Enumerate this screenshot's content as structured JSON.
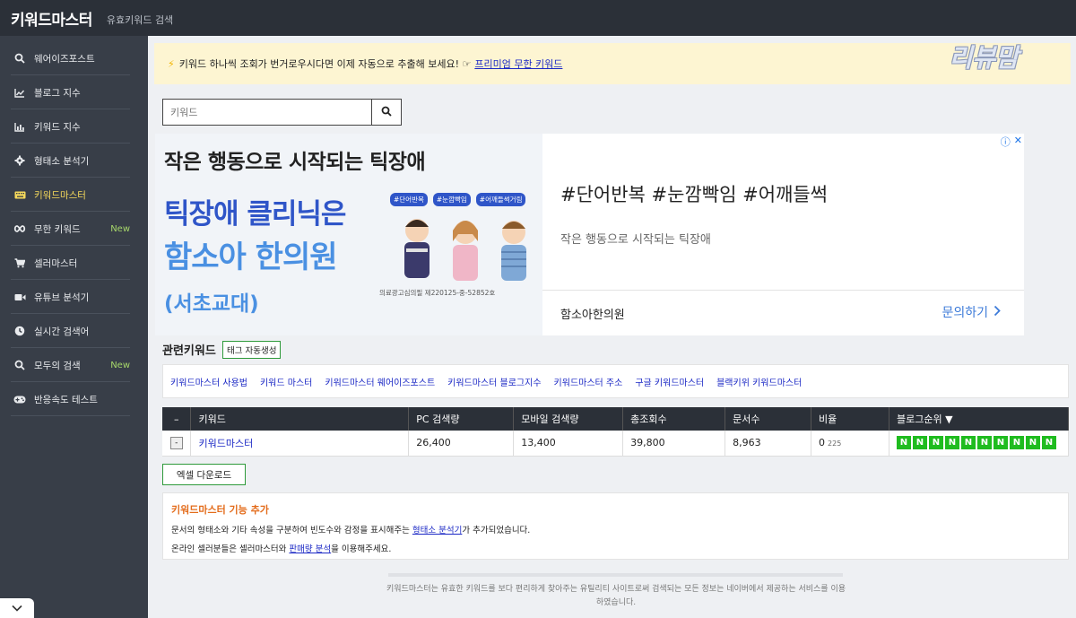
{
  "header": {
    "brand": "키워드마스터",
    "subtitle": "유효키워드 검색"
  },
  "sidebar": {
    "items": [
      {
        "label": "웨어이즈포스트",
        "icon": "search-icon"
      },
      {
        "label": "블로그 지수",
        "icon": "line-chart-icon"
      },
      {
        "label": "키워드 지수",
        "icon": "bar-chart-icon"
      },
      {
        "label": "형태소 분석기",
        "icon": "gear-icon"
      },
      {
        "label": "키워드마스터",
        "icon": "keyboard-icon",
        "active": true
      },
      {
        "label": "무한 키워드",
        "icon": "infinity-icon",
        "badge": "New"
      },
      {
        "label": "셀러마스터",
        "icon": "cart-icon"
      },
      {
        "label": "유튜브 분석기",
        "icon": "video-camera-icon"
      },
      {
        "label": "실시간 검색어",
        "icon": "clock-icon"
      },
      {
        "label": "모두의 검색",
        "icon": "search-icon",
        "badge": "New"
      },
      {
        "label": "반응속도 테스트",
        "icon": "gamepad-icon"
      }
    ]
  },
  "notice": {
    "text": "키워드 하나씩 조회가 번거로우시다면 이제 자동으로 추출해 보세요! ☞",
    "link": "프리미엄 무한 키워드",
    "watermark": "리뷰맘"
  },
  "search": {
    "placeholder": "키워드"
  },
  "ad": {
    "headline": "작은 행동으로 시작되는 틱장애",
    "big1": "틱장애 클리닉은",
    "big2": "함소아 한의원",
    "big3": "(서초교대)",
    "tags": [
      "#단어반복",
      "#눈깜빡임",
      "#어깨들썩거림"
    ],
    "permit": "의료광고심의필 제220125-중-52852호",
    "right_title": "#단어반복 #눈깜빡임 #어깨들썩",
    "right_sub": "작은 행동으로 시작되는 틱장애",
    "advertiser": "함소아한의원",
    "cta": "문의하기"
  },
  "related": {
    "title": "관련키워드",
    "tag_button": "태그 자동생성",
    "keywords": [
      "키워드마스터 사용법",
      "키워드 마스터",
      "키워드마스터 웨어이즈포스트",
      "키워드마스터 블로그지수",
      "키워드마스터 주소",
      "구글 키워드마스터",
      "블랙키위 키워드마스터"
    ]
  },
  "table": {
    "headers": [
      "–",
      "키워드",
      "PC 검색량",
      "모바일 검색량",
      "총조회수",
      "문서수",
      "비율",
      "블로그순위 ▼"
    ],
    "rows": [
      {
        "btn": "-",
        "keyword": "키워드마스터",
        "pc": "26,400",
        "mobile": "13,400",
        "total": "39,800",
        "docs": "8,963",
        "ratio": "0",
        "ratio_small": "225",
        "ranks": [
          "N",
          "N",
          "N",
          "N",
          "N",
          "N",
          "N",
          "N",
          "N",
          "N"
        ]
      }
    ]
  },
  "excel_button": "엑셀 다운로드",
  "feature": {
    "title": "키워드마스터 기능 추가",
    "line1_pre": "문서의 형태소와 기타 속성을 구분하여 빈도수와 감정을 표시해주는 ",
    "line1_link": "형태소 분석기",
    "line1_post": "가 추가되었습니다.",
    "line2_pre": "온라인 셀러분들은 셀러마스터와 ",
    "line2_link": "판매량 분석",
    "line2_post": "을 이용해주세요."
  },
  "footer": {
    "text": "키워드마스터는 유효한 키워드를 보다 편리하게 찾아주는 유틸리티 사이트로써 검색되는 모든 정보는 네이버에서 제공하는 서비스를 이용하였습니다."
  },
  "colors": {
    "topbar": "#2b3038",
    "sidebar": "#383e48",
    "active": "#f6d95b",
    "new_badge": "#a6d66a",
    "link": "#1b28c5",
    "rank_green": "#1fbc1f",
    "notice_bg": "#fdf5d2"
  }
}
